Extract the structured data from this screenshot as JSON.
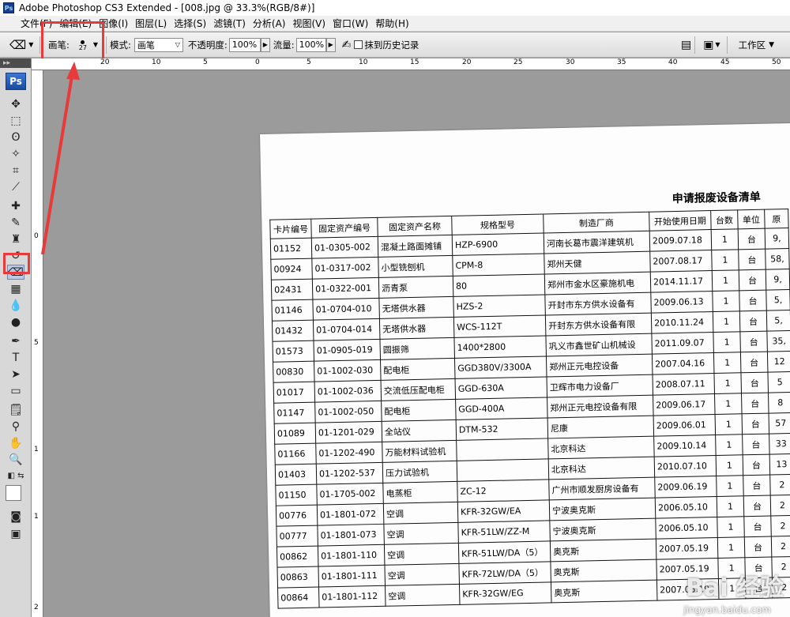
{
  "window": {
    "title": "Adobe Photoshop CS3 Extended - [008.jpg @ 33.3%(RGB/8#)]",
    "app_badge": "Ps"
  },
  "menu": [
    "文件(F)",
    "编辑(E)",
    "图像(I)",
    "图层(L)",
    "选择(S)",
    "滤镜(T)",
    "分析(A)",
    "视图(V)",
    "窗口(W)",
    "帮助(H)"
  ],
  "options": {
    "brush_label": "画笔:",
    "brush_size": "27",
    "mode_label": "模式:",
    "mode_value": "画笔",
    "opacity_label": "不透明度:",
    "opacity_value": "100%",
    "flow_label": "流量:",
    "flow_value": "100%",
    "erase_history_label": "抹到历史记录",
    "workspace_label": "工作区"
  },
  "ruler_top_ticks": [
    "20",
    "10",
    "5",
    "0",
    "5",
    "10",
    "15",
    "20",
    "25",
    "30",
    "35",
    "40",
    "45",
    "50"
  ],
  "ruler_left_ticks": [
    "0",
    "5",
    "1",
    "1",
    "2"
  ],
  "document": {
    "title": "申请报废设备清单",
    "headers": [
      "卡片编号",
      "固定资产编号",
      "固定资产名称",
      "规格型号",
      "制造厂商",
      "开始使用日期",
      "台数",
      "单位",
      "原"
    ],
    "rows": [
      [
        "01152",
        "01-0305-002",
        "混凝土路面摊铺",
        "HZP-6900",
        "河南长葛市震洋建筑机",
        "2009.07.18",
        "1",
        "台",
        "9,"
      ],
      [
        "00924",
        "01-0317-002",
        "小型铣刨机",
        "CPM-8",
        "郑州天健",
        "2007.08.17",
        "1",
        "台",
        "58,"
      ],
      [
        "02431",
        "01-0322-001",
        "沥青泵",
        "80",
        "郑州市金水区豪施机电",
        "2014.11.17",
        "1",
        "台",
        "9,"
      ],
      [
        "01146",
        "01-0704-010",
        "无塔供水器",
        "HZS-2",
        "开封市东方供水设备有",
        "2009.06.13",
        "1",
        "台",
        "5,"
      ],
      [
        "01432",
        "01-0704-014",
        "无塔供水器",
        "WCS-112T",
        "开封东方供水设备有限",
        "2010.11.24",
        "1",
        "台",
        "5,"
      ],
      [
        "01573",
        "01-0905-019",
        "圆振筛",
        "1400*2800",
        "巩义市鑫世矿山机械设",
        "2011.09.07",
        "1",
        "台",
        "35,"
      ],
      [
        "00830",
        "01-1002-030",
        "配电柜",
        "GGD380V/3300A",
        "郑州正元电控设备",
        "2007.04.16",
        "1",
        "台",
        "12"
      ],
      [
        "01017",
        "01-1002-036",
        "交流低压配电柜",
        "GGD-630A",
        "卫辉市电力设备厂",
        "2008.07.11",
        "1",
        "台",
        "5"
      ],
      [
        "01147",
        "01-1002-050",
        "配电柜",
        "GGD-400A",
        "郑州正元电控设备有限",
        "2009.06.17",
        "1",
        "台",
        "8"
      ],
      [
        "01089",
        "01-1201-029",
        "全站仪",
        "DTM-532",
        "尼康",
        "2009.06.01",
        "1",
        "台",
        "57"
      ],
      [
        "01166",
        "01-1202-490",
        "万能材料试验机",
        "",
        "北京科达",
        "2009.10.14",
        "1",
        "台",
        "33"
      ],
      [
        "01403",
        "01-1202-537",
        "压力试验机",
        "",
        "北京科达",
        "2010.07.10",
        "1",
        "台",
        "13"
      ],
      [
        "01150",
        "01-1705-002",
        "电蒸柜",
        "ZC-12",
        "广州市顺发厨房设备有",
        "2009.06.19",
        "1",
        "台",
        "2"
      ],
      [
        "00776",
        "01-1801-072",
        "空调",
        "KFR-32GW/EA",
        "宁波奥克斯",
        "2006.05.10",
        "1",
        "台",
        "2"
      ],
      [
        "00777",
        "01-1801-073",
        "空调",
        "KFR-51LW/ZZ-M",
        "宁波奥克斯",
        "2006.05.10",
        "1",
        "台",
        "2"
      ],
      [
        "00862",
        "01-1801-110",
        "空调",
        "KFR-51LW/DA（5）",
        "奥克斯",
        "2007.05.19",
        "1",
        "台",
        "2"
      ],
      [
        "00863",
        "01-1801-111",
        "空调",
        "KFR-72LW/DA（5）",
        "奥克斯",
        "2007.05.19",
        "1",
        "台",
        "2"
      ],
      [
        "00864",
        "01-1801-112",
        "空调",
        "KFR-32GW/EG",
        "奥克斯",
        "2007.05.19",
        "1",
        "台",
        "2"
      ]
    ]
  },
  "watermark": {
    "main": "Bai 经验",
    "sub": "jingyan.baidu.com"
  }
}
